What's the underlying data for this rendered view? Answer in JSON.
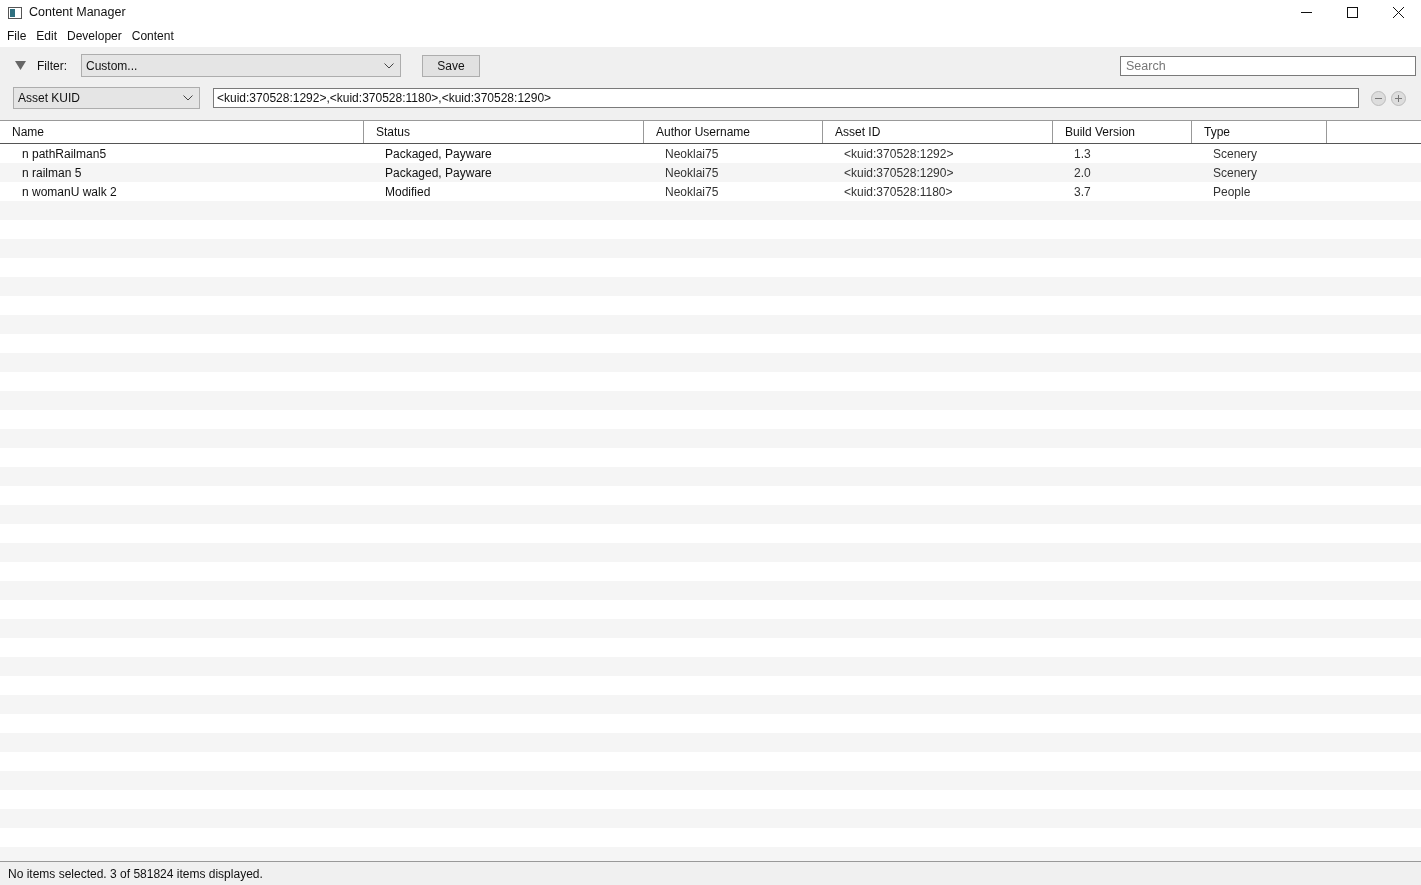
{
  "window": {
    "title": "Content Manager"
  },
  "menu": [
    "File",
    "Edit",
    "Developer",
    "Content"
  ],
  "filter": {
    "label": "Filter:",
    "value": "Custom...",
    "save": "Save",
    "search": {
      "placeholder": "Search"
    }
  },
  "query": {
    "field": "Asset KUID",
    "value": "<kuid:370528:1292>,<kuid:370528:1180>,<kuid:370528:1290>"
  },
  "table": {
    "columns": [
      "Name",
      "Status",
      "Author Username",
      "Asset ID",
      "Build Version",
      "Type"
    ],
    "rows": [
      [
        "n pathRailman5",
        "Packaged, Payware",
        "Neoklai75",
        "<kuid:370528:1292>",
        "1.3",
        "Scenery"
      ],
      [
        "n railman 5",
        "Packaged, Payware",
        "Neoklai75",
        "<kuid:370528:1290>",
        "2.0",
        "Scenery"
      ],
      [
        "n womanU walk 2",
        "Modified",
        "Neoklai75",
        "<kuid:370528:1180>",
        "3.7",
        "People"
      ]
    ]
  },
  "status_bar": "No items selected. 3 of 581824 items displayed."
}
